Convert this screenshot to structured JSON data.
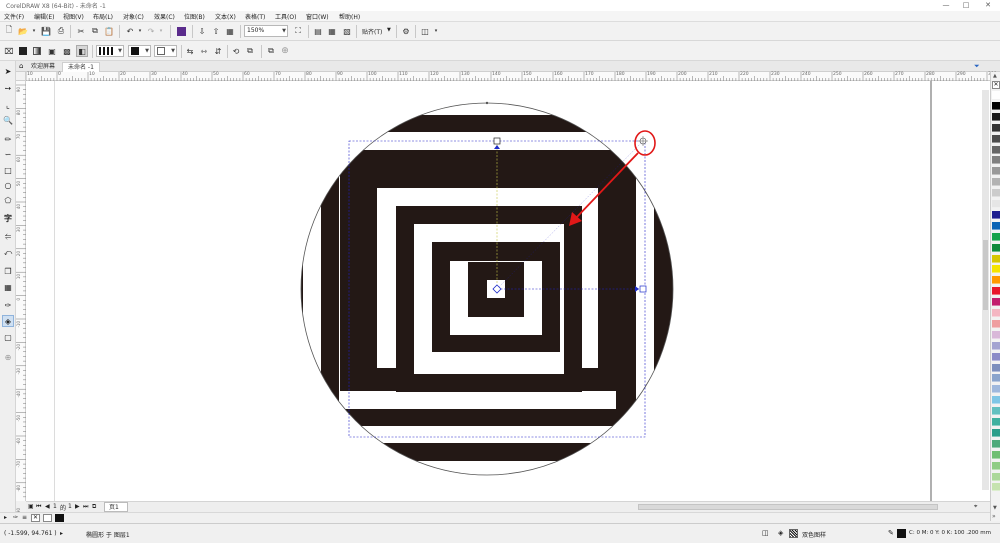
{
  "window": {
    "title": "CorelDRAW X8 (64-Bit) - 未命名 -1",
    "controls": [
      "—",
      "□",
      "✕"
    ]
  },
  "menu": [
    "文件(F)",
    "编辑(E)",
    "视图(V)",
    "布局(L)",
    "对象(C)",
    "效果(C)",
    "位图(B)",
    "文本(X)",
    "表格(T)",
    "工具(O)",
    "窗口(W)",
    "帮助(H)"
  ],
  "toolbar1": {
    "zoom_value": "150%",
    "snap_label": "贴齐(T)"
  },
  "tabs": [
    {
      "label": "欢迎屏幕",
      "active": false
    },
    {
      "label": "未命名 -1",
      "active": true
    }
  ],
  "ruler": {
    "h_labels": [
      "10",
      "0",
      "10",
      "20",
      "30",
      "40",
      "50",
      "60",
      "70",
      "80",
      "90",
      "100",
      "110",
      "120",
      "130",
      "140",
      "150",
      "160",
      "170",
      "180",
      "190",
      "200",
      "210",
      "220",
      "230",
      "240",
      "250",
      "260",
      "270",
      "280",
      "290",
      "300"
    ],
    "v_labels": [
      "90",
      "80",
      "70",
      "60",
      "50",
      "40",
      "30",
      "20",
      "10",
      "0",
      "-10",
      "-20",
      "-30",
      "-40",
      "-50",
      "-60",
      "-70",
      "-80",
      "-90"
    ]
  },
  "page_nav": {
    "current": "1",
    "of_label": "的",
    "total": "1",
    "page_tab": "页1"
  },
  "status": {
    "coords": "( -1.599, 94.761 )",
    "object_info": "椭圆形 于 图层1",
    "fill_label": "双色图样",
    "outline_info": "C: 0 M: 0 Y: 0 K: 100  .200 mm"
  },
  "colors": {
    "ink": "#231815",
    "accent_red": "#e11818",
    "guide_blue": "#2020c8",
    "anchor_blue": "#1c2bc8"
  },
  "palette": [
    "#ffffff",
    "#000000",
    "#1a1a1a",
    "#333333",
    "#4d4d4d",
    "#666666",
    "#808080",
    "#999999",
    "#b3b3b3",
    "#cccccc",
    "#e6e6e6",
    "#1d1d8f",
    "#0a63b5",
    "#16a34a",
    "#0f8a3c",
    "#d6c600",
    "#f5e400",
    "#ff9900",
    "#e8162b",
    "#c21e6e",
    "#f4b6c2",
    "#ef9ea0",
    "#d9b8d9",
    "#a3a3d1",
    "#8c8cc7",
    "#7d8fbd",
    "#8aa4cc",
    "#9fb8dd",
    "#7fc6e6",
    "#62c0c0",
    "#3fb0a0",
    "#2b9e8a",
    "#4daa7a",
    "#6fbf73",
    "#8fcd85",
    "#acd89a",
    "#c6e3b0"
  ]
}
